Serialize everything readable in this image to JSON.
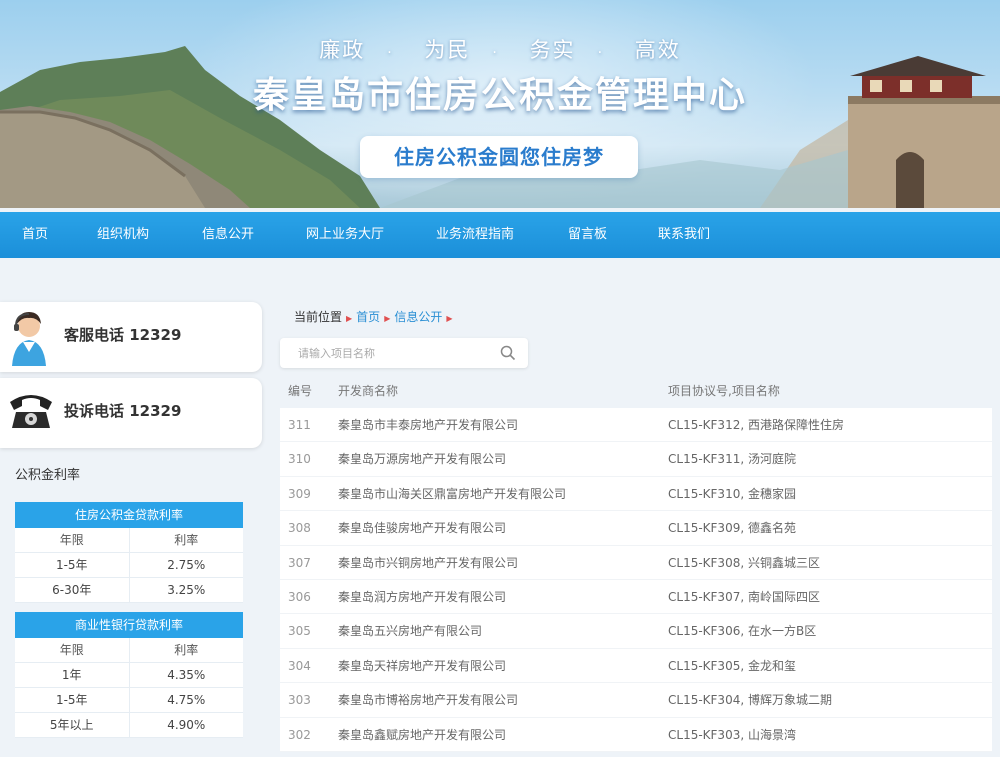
{
  "banner": {
    "slogan": [
      "廉政",
      "为民",
      "务实",
      "高效"
    ],
    "dot": "·",
    "title": "秦皇岛市住房公积金管理中心",
    "motto": "住房公积金圆您住房梦"
  },
  "nav": {
    "items": [
      "首页",
      "组织机构",
      "信息公开",
      "网上业务大厅",
      "业务流程指南",
      "留言板",
      "联系我们"
    ]
  },
  "sidebar": {
    "service_phone": "客服电话 12329",
    "complaint_phone": "投诉电话 12329",
    "rates_heading": "公积金利率",
    "housing_fund_table": {
      "caption": "住房公积金贷款利率",
      "col_term": "年限",
      "col_rate": "利率",
      "rows": [
        {
          "term": "1-5年",
          "rate": "2.75%"
        },
        {
          "term": "6-30年",
          "rate": "3.25%"
        }
      ]
    },
    "commercial_table": {
      "caption": "商业性银行贷款利率",
      "col_term": "年限",
      "col_rate": "利率",
      "rows": [
        {
          "term": "1年",
          "rate": "4.35%"
        },
        {
          "term": "1-5年",
          "rate": "4.75%"
        },
        {
          "term": "5年以上",
          "rate": "4.90%"
        }
      ]
    }
  },
  "main": {
    "breadcrumb": {
      "prefix": "当前位置",
      "home": "首页",
      "current": "信息公开"
    },
    "search": {
      "placeholder": "请输入项目名称"
    },
    "columns": {
      "id": "编号",
      "developer": "开发商名称",
      "project": "项目协议号,项目名称"
    },
    "rows": [
      {
        "id": "311",
        "developer": "秦皇岛市丰泰房地产开发有限公司",
        "project": "CL15-KF312, 西港路保障性住房"
      },
      {
        "id": "310",
        "developer": "秦皇岛万源房地产开发有限公司",
        "project": "CL15-KF311, 汤河庭院"
      },
      {
        "id": "309",
        "developer": "秦皇岛市山海关区鼎富房地产开发有限公司",
        "project": "CL15-KF310, 金穗家园"
      },
      {
        "id": "308",
        "developer": "秦皇岛佳骏房地产开发有限公司",
        "project": "CL15-KF309, 德鑫名苑"
      },
      {
        "id": "307",
        "developer": "秦皇岛市兴铜房地产开发有限公司",
        "project": "CL15-KF308, 兴铜鑫城三区"
      },
      {
        "id": "306",
        "developer": "秦皇岛润方房地产开发有限公司",
        "project": "CL15-KF307, 南岭国际四区"
      },
      {
        "id": "305",
        "developer": "秦皇岛五兴房地产有限公司",
        "project": "CL15-KF306, 在水一方B区"
      },
      {
        "id": "304",
        "developer": "秦皇岛天祥房地产开发有限公司",
        "project": "CL15-KF305, 金龙和玺"
      },
      {
        "id": "303",
        "developer": "秦皇岛市博裕房地产开发有限公司",
        "project": "CL15-KF304, 博辉万象城二期"
      },
      {
        "id": "302",
        "developer": "秦皇岛鑫赋房地产开发有限公司",
        "project": "CL15-KF303, 山海景湾"
      }
    ]
  }
}
